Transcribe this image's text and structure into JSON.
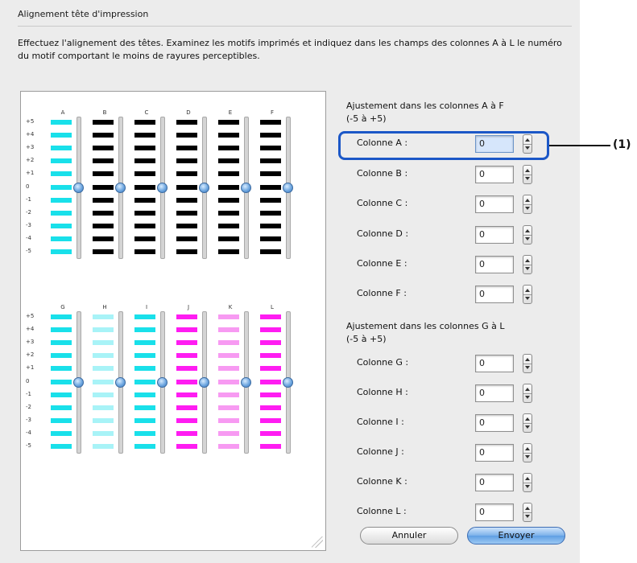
{
  "dialog": {
    "title": "Alignement tête d'impression",
    "description": "Effectuez l'alignement des têtes. Examinez les motifs imprimés et indiquez dans les champs des colonnes A à L le numéro du motif comportant le moins de rayures perceptibles."
  },
  "patterns": {
    "row_labels": [
      "+5",
      "+4",
      "+3",
      "+2",
      "+1",
      "0",
      "-1",
      "-2",
      "-3",
      "-4",
      "-5"
    ],
    "group1": {
      "columns": [
        {
          "id": "A",
          "color": "#19e0ea"
        },
        {
          "id": "B",
          "color": "#000000"
        },
        {
          "id": "C",
          "color": "#000000"
        },
        {
          "id": "D",
          "color": "#000000"
        },
        {
          "id": "E",
          "color": "#000000"
        },
        {
          "id": "F",
          "color": "#000000"
        }
      ]
    },
    "group2": {
      "columns": [
        {
          "id": "G",
          "color": "#19e0ea"
        },
        {
          "id": "H",
          "color": "#a8f3f7"
        },
        {
          "id": "I",
          "color": "#19e0ea"
        },
        {
          "id": "J",
          "color": "#ff1cf2"
        },
        {
          "id": "K",
          "color": "#f79af2"
        },
        {
          "id": "L",
          "color": "#ff1cf2"
        }
      ]
    },
    "slider_level": "0"
  },
  "section1": {
    "heading_line1": "Ajustement dans les colonnes A à F",
    "heading_line2": "(-5 à +5)"
  },
  "section2": {
    "heading_line1": "Ajustement dans les colonnes G à L",
    "heading_line2": "(-5 à +5)"
  },
  "fields": [
    {
      "label": "Colonne A :",
      "value": "0"
    },
    {
      "label": "Colonne B :",
      "value": "0"
    },
    {
      "label": "Colonne C :",
      "value": "0"
    },
    {
      "label": "Colonne D :",
      "value": "0"
    },
    {
      "label": "Colonne E :",
      "value": "0"
    },
    {
      "label": "Colonne F :",
      "value": "0"
    },
    {
      "label": "Colonne G :",
      "value": "0"
    },
    {
      "label": "Colonne H :",
      "value": "0"
    },
    {
      "label": "Colonne I :",
      "value": "0"
    },
    {
      "label": "Colonne J :",
      "value": "0"
    },
    {
      "label": "Colonne K :",
      "value": "0"
    },
    {
      "label": "Colonne L :",
      "value": "0"
    }
  ],
  "callout": {
    "label": "(1)"
  },
  "buttons": {
    "cancel": "Annuler",
    "send": "Envoyer"
  },
  "colors": {
    "highlight": "#1b57c7",
    "default_button": "#7cb1ea"
  }
}
